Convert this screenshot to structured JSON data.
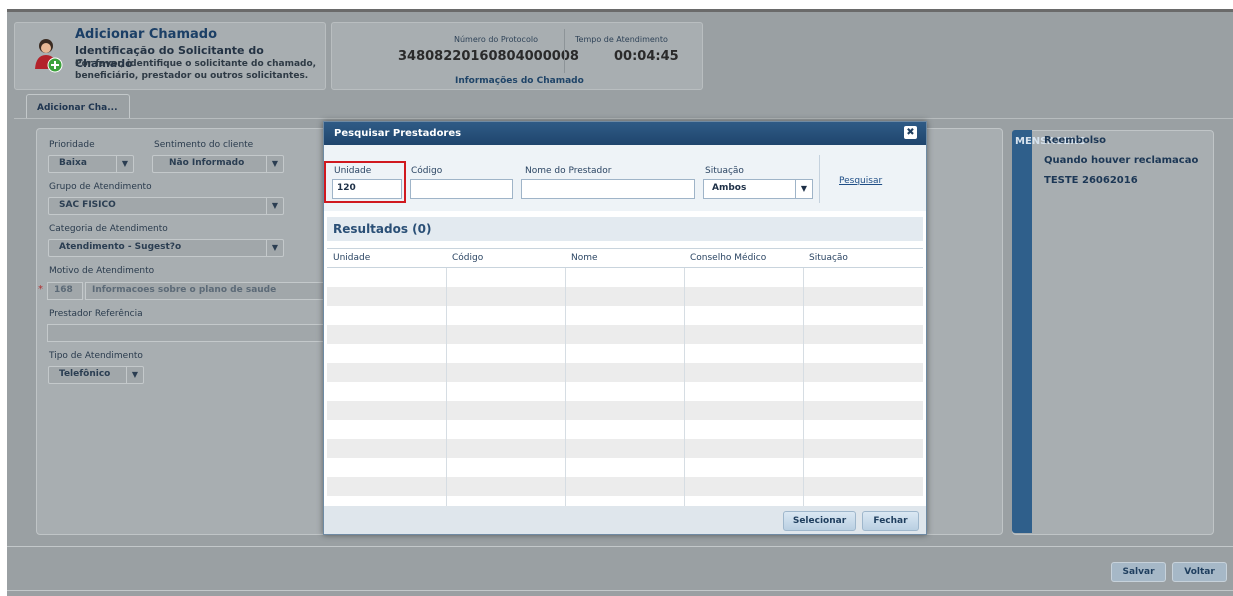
{
  "header": {
    "title": "Adicionar Chamado",
    "subtitle": "Identificação do Solicitante do Chamado",
    "description": "Por favor, identifique o solicitante do chamado, beneficiário, prestador ou outros solicitantes."
  },
  "protocol": {
    "number_label": "Número do Protocolo",
    "number_value": "34808220160804000008",
    "time_label": "Tempo de Atendimento",
    "time_value": "00:04:45",
    "info_link": "Informações do Chamado"
  },
  "tab": {
    "label": "Adicionar Cha..."
  },
  "form": {
    "priority_label": "Prioridade",
    "priority_value": "Baixa",
    "sentiment_label": "Sentimento do cliente",
    "sentiment_value": "Não Informado",
    "group_label": "Grupo de Atendimento",
    "group_value": "SAC FISICO",
    "category_label": "Categoria de Atendimento",
    "category_value": "Atendimento - Sugest?o",
    "reason_label": "Motivo de Atendimento",
    "reason_code": "168",
    "reason_text": "Informacoes sobre o plano de saude",
    "required_mark": "*",
    "provider_ref_label": "Prestador Referência",
    "type_label": "Tipo de Atendimento",
    "type_value": "Telefônico"
  },
  "messages": {
    "bar_label": "MENSAGENS",
    "items": [
      "Reembolso",
      "Quando houver reclamacao",
      "TESTE 26062016"
    ]
  },
  "footer": {
    "save_label": "Salvar",
    "back_label": "Voltar"
  },
  "modal": {
    "title": "Pesquisar Prestadores",
    "close_glyph": "✖",
    "unit_label": "Unidade",
    "unit_value": "120",
    "code_label": "Código",
    "code_value": "",
    "name_label": "Nome do Prestador",
    "name_value": "",
    "status_label": "Situação",
    "status_value": "Ambos",
    "search_link": "Pesquisar",
    "results_title": "Resultados (0)",
    "columns": [
      "Unidade",
      "Código",
      "Nome",
      "Conselho Médico",
      "Situação"
    ],
    "select_label": "Selecionar",
    "close_label": "Fechar"
  },
  "icons": {
    "dropdown": "chevron-down-icon",
    "close": "close-icon",
    "avatar": "user-add-icon"
  },
  "colors": {
    "modal_header": "#2f5b86",
    "highlight": "#d0191f",
    "messages_bar": "#2f5f8b"
  }
}
